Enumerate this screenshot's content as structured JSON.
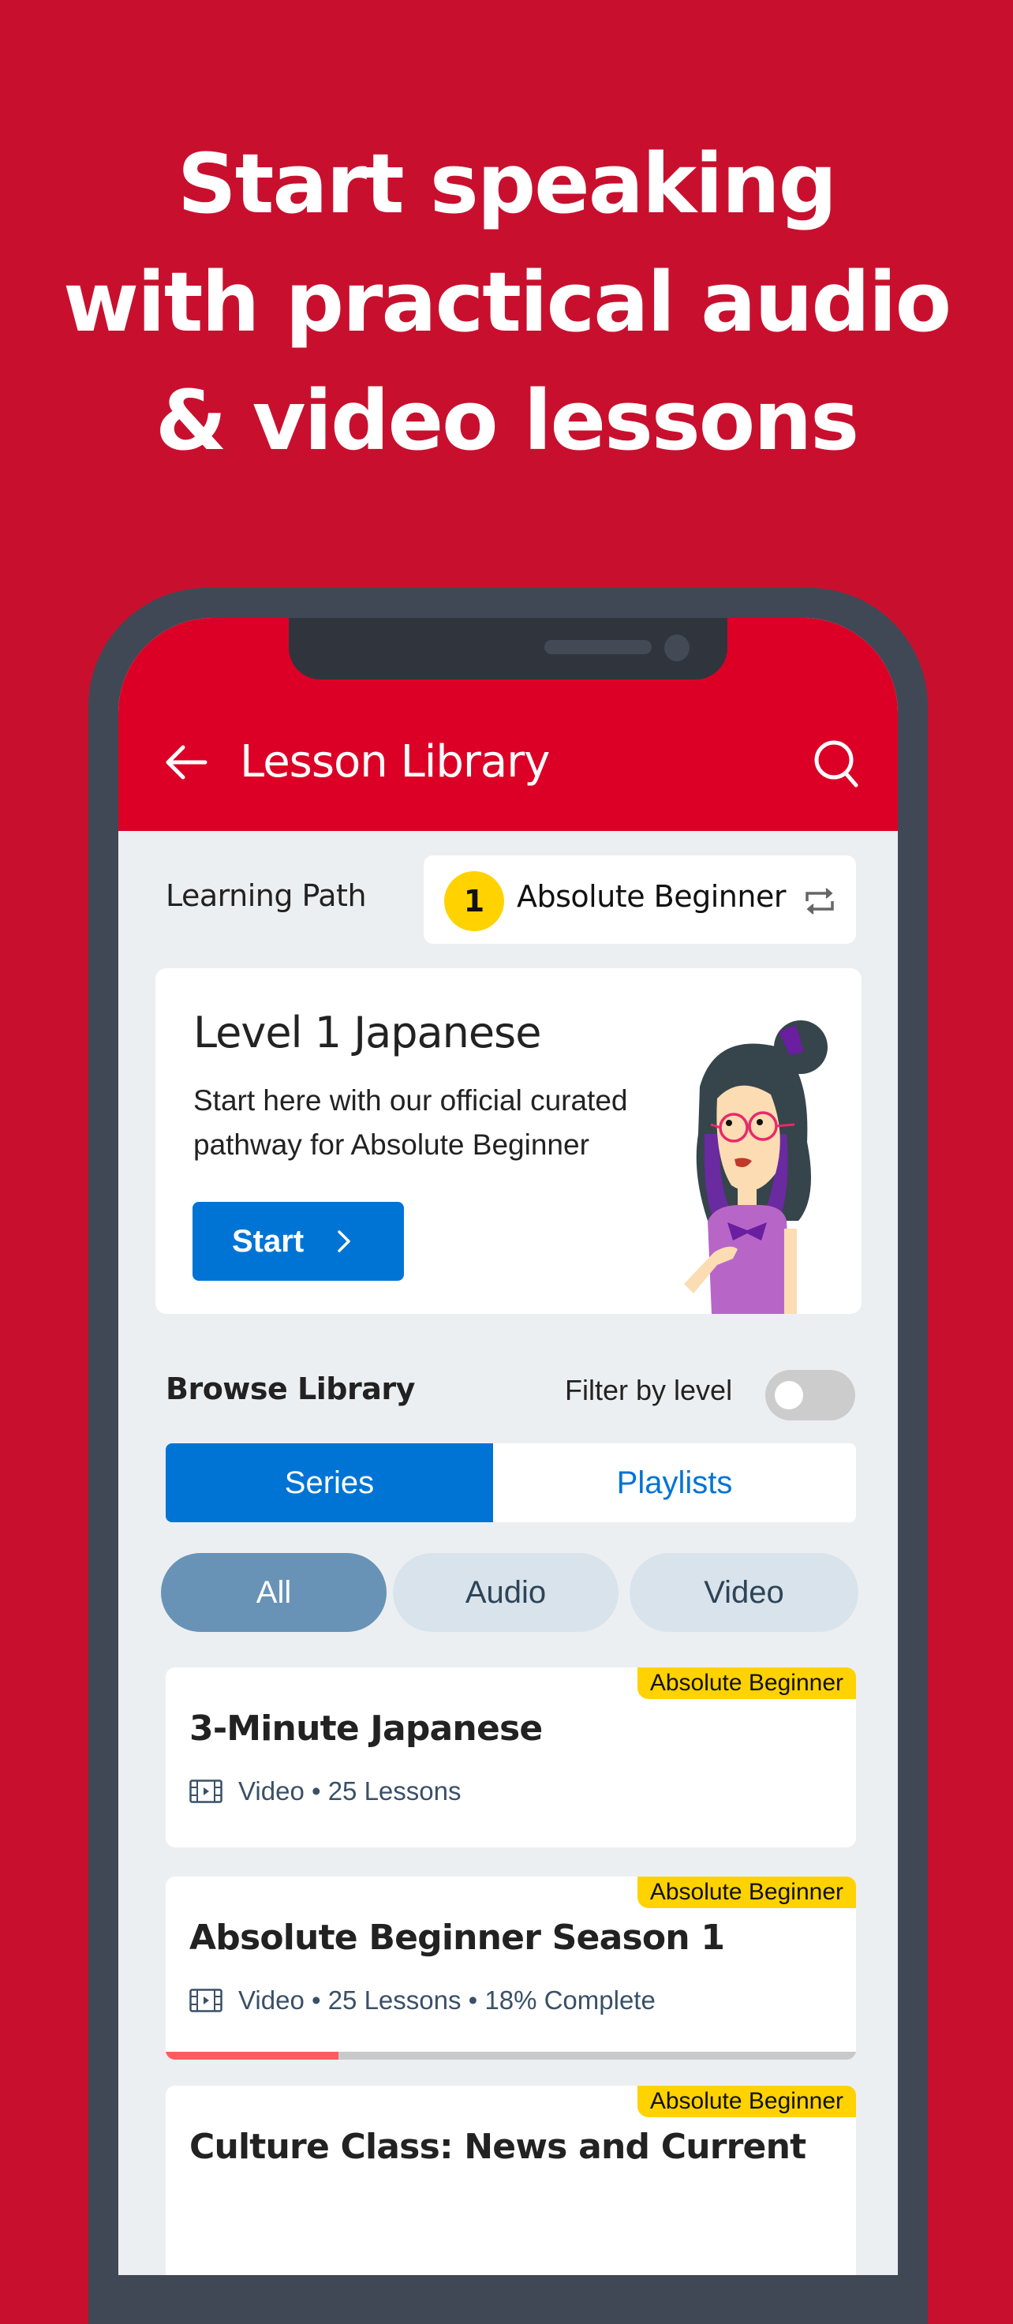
{
  "headline": {
    "lines": [
      "Start speaking",
      "with practical audio",
      "& video lessons"
    ]
  },
  "appbar": {
    "title": "Lesson Library",
    "back_icon": "arrow-left-icon",
    "search_icon": "search-icon"
  },
  "learning_path": {
    "label": "Learning Path",
    "level_number": "1",
    "level_name": "Absolute Beginner",
    "swap_icon": "swap-icon"
  },
  "hero": {
    "title": "Level 1 Japanese",
    "description": "Start here with our official curated pathway for Absolute Beginner",
    "button_label": "Start"
  },
  "browse": {
    "label": "Browse Library",
    "filter_label": "Filter by level",
    "filter_enabled": false,
    "tabs": [
      {
        "label": "Series",
        "active": true
      },
      {
        "label": "Playlists",
        "active": false
      }
    ],
    "chips": [
      {
        "label": "All",
        "active": true
      },
      {
        "label": "Audio",
        "active": false
      },
      {
        "label": "Video",
        "active": false
      }
    ]
  },
  "series": [
    {
      "badge": "Absolute Beginner",
      "title": "3-Minute Japanese",
      "meta": "Video • 25 Lessons",
      "media_icon": "film-icon"
    },
    {
      "badge": "Absolute Beginner",
      "title": "Absolute Beginner Season 1",
      "meta": "Video • 25 Lessons • 18% Complete",
      "media_icon": "film-icon",
      "progress": 0.25
    },
    {
      "badge": "Absolute Beginner",
      "title": "Culture Class: News and Current"
    }
  ],
  "colors": {
    "background_red": "#c8102e",
    "appbar_red": "#dc0026",
    "accent_blue": "#0074d4",
    "badge_yellow": "#ffd200",
    "progress_red": "#ff5a5f",
    "chip_active": "#6893b6"
  }
}
